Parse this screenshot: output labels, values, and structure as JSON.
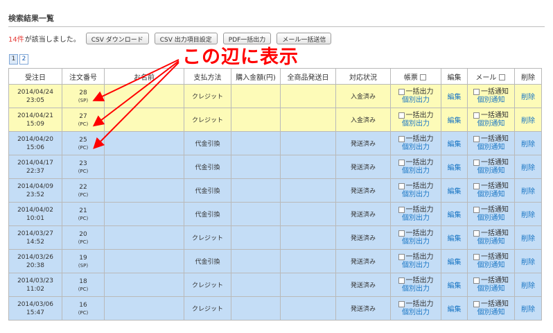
{
  "page": {
    "title": "検索結果一覧",
    "result_count": "14件",
    "result_text": "が該当しました。",
    "callout": "この辺に表示"
  },
  "toolbar": {
    "csv_download": "CSV ダウンロード",
    "csv_settings": "CSV 出力項目設定",
    "pdf_bulk": "PDF一括出力",
    "mail_bulk": "メール一括送信"
  },
  "pager": [
    "1",
    "2"
  ],
  "columns": {
    "order_date": "受注日",
    "order_no": "注文番号",
    "name": "お名前",
    "payment": "支払方法",
    "amount": "購入金額(円)",
    "ship_date": "全商品発送日",
    "status": "対応状況",
    "ticket": "帳票",
    "edit": "編集",
    "mail": "メール",
    "delete": "削除"
  },
  "cell_labels": {
    "bulk_output": "一括出力",
    "individual_output": "個別出力",
    "bulk_notify": "一括通知",
    "individual_notify": "個別通知",
    "edit": "編集",
    "delete": "削除"
  },
  "rows": [
    {
      "date": "2014/04/24",
      "time": "23:05",
      "no": "28",
      "tag": "(SP)",
      "payment": "クレジット",
      "status": "入金済み",
      "row_type": "paid"
    },
    {
      "date": "2014/04/21",
      "time": "15:09",
      "no": "27",
      "tag": "(PC)",
      "payment": "クレジット",
      "status": "入金済み",
      "row_type": "paid"
    },
    {
      "date": "2014/04/20",
      "time": "15:06",
      "no": "25",
      "tag": "(PC)",
      "payment": "代金引換",
      "status": "発送済み",
      "row_type": "shipped"
    },
    {
      "date": "2014/04/17",
      "time": "22:37",
      "no": "23",
      "tag": "(PC)",
      "payment": "代金引換",
      "status": "発送済み",
      "row_type": "shipped"
    },
    {
      "date": "2014/04/09",
      "time": "23:52",
      "no": "22",
      "tag": "(PC)",
      "payment": "代金引換",
      "status": "発送済み",
      "row_type": "shipped"
    },
    {
      "date": "2014/04/02",
      "time": "10:01",
      "no": "21",
      "tag": "(PC)",
      "payment": "代金引換",
      "status": "発送済み",
      "row_type": "shipped"
    },
    {
      "date": "2014/03/27",
      "time": "14:52",
      "no": "20",
      "tag": "(PC)",
      "payment": "クレジット",
      "status": "発送済み",
      "row_type": "shipped"
    },
    {
      "date": "2014/03/26",
      "time": "20:38",
      "no": "19",
      "tag": "(SP)",
      "payment": "代金引換",
      "status": "発送済み",
      "row_type": "shipped"
    },
    {
      "date": "2014/03/23",
      "time": "11:02",
      "no": "18",
      "tag": "(PC)",
      "payment": "クレジット",
      "status": "発送済み",
      "row_type": "shipped"
    },
    {
      "date": "2014/03/06",
      "time": "15:47",
      "no": "16",
      "tag": "(PC)",
      "payment": "クレジット",
      "status": "発送済み",
      "row_type": "shipped"
    }
  ],
  "colors": {
    "paid_row": "#fdfbb8",
    "shipped_row": "#c4ddf6",
    "callout": "#ff0000",
    "link": "#1a76c4"
  }
}
